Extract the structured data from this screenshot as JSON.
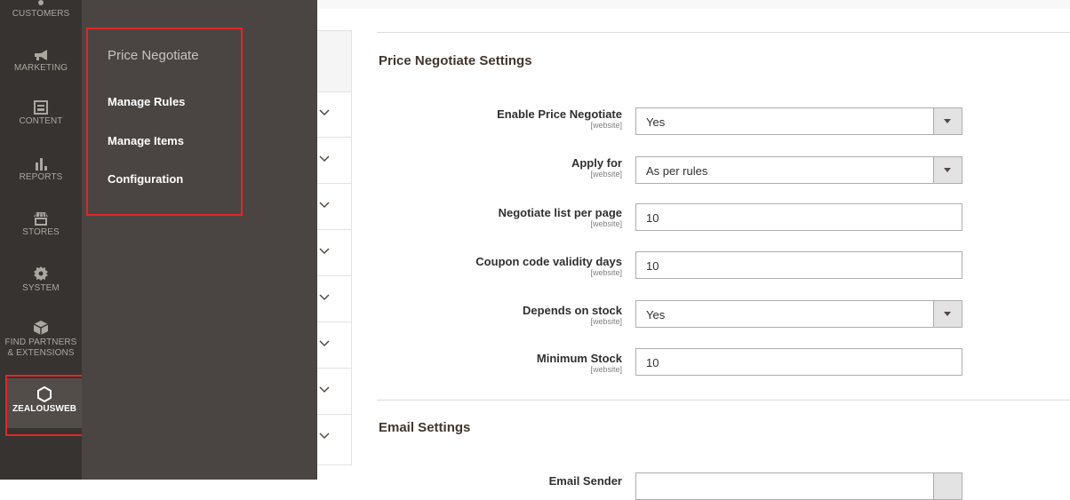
{
  "admin_nav": {
    "items": [
      {
        "label": "CUSTOMERS",
        "icon": "customers-icon"
      },
      {
        "label": "MARKETING",
        "icon": "megaphone-icon"
      },
      {
        "label": "CONTENT",
        "icon": "content-icon"
      },
      {
        "label": "REPORTS",
        "icon": "bar-chart-icon"
      },
      {
        "label": "STORES",
        "icon": "store-icon"
      },
      {
        "label": "SYSTEM",
        "icon": "gear-icon"
      },
      {
        "label_line1": "FIND PARTNERS",
        "label_line2": "& EXTENSIONS",
        "icon": "cube-icon"
      },
      {
        "label": "ZEALOUSWEB",
        "icon": "hexagon-icon",
        "active": true
      }
    ]
  },
  "flyout": {
    "title": "Price Negotiate",
    "links": [
      "Manage Rules",
      "Manage Items",
      "Configuration"
    ]
  },
  "sections": {
    "price_negotiate": {
      "title": "Price Negotiate Settings",
      "fields": [
        {
          "label": "Enable Price Negotiate",
          "scope": "[website]",
          "value": "Yes",
          "type": "select"
        },
        {
          "label": "Apply for",
          "scope": "[website]",
          "value": "As per rules",
          "type": "select"
        },
        {
          "label": "Negotiate list per page",
          "scope": "[website]",
          "value": "10",
          "type": "text"
        },
        {
          "label": "Coupon code validity days",
          "scope": "[website]",
          "value": "10",
          "type": "text"
        },
        {
          "label": "Depends on stock",
          "scope": "[website]",
          "value": "Yes",
          "type": "select"
        },
        {
          "label": "Minimum Stock",
          "scope": "[website]",
          "value": "10",
          "type": "text"
        }
      ]
    },
    "email": {
      "title": "Email Settings",
      "partial_label": "Email Sender"
    }
  },
  "colors": {
    "nav_bg": "#373330",
    "flyout_bg": "#4a4542",
    "highlight_red": "#e22626"
  }
}
